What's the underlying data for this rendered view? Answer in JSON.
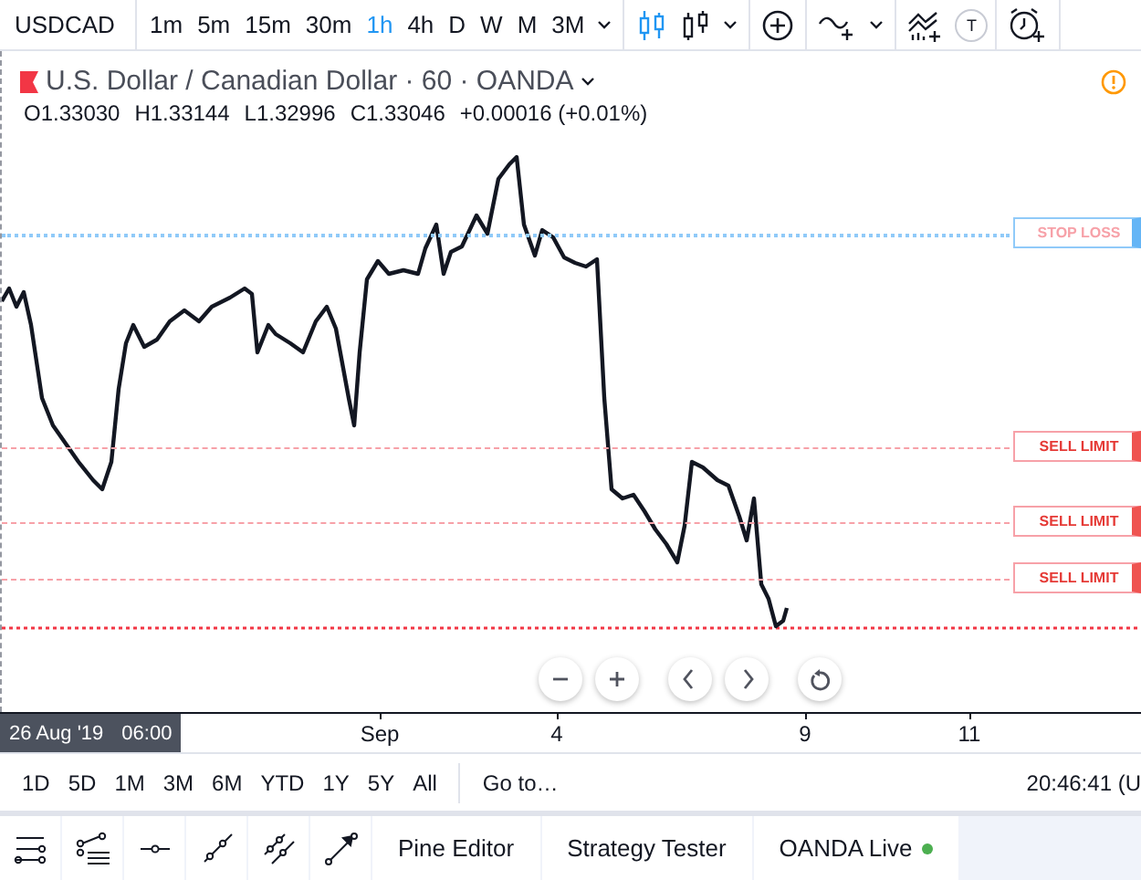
{
  "symbol": "USDCAD",
  "intervals": [
    {
      "label": "1m",
      "selected": false
    },
    {
      "label": "5m",
      "selected": false
    },
    {
      "label": "15m",
      "selected": false
    },
    {
      "label": "30m",
      "selected": false
    },
    {
      "label": "1h",
      "selected": true
    },
    {
      "label": "4h",
      "selected": false
    },
    {
      "label": "D",
      "selected": false
    },
    {
      "label": "W",
      "selected": false
    },
    {
      "label": "M",
      "selected": false
    },
    {
      "label": "3M",
      "selected": false
    }
  ],
  "text_tool": "T",
  "legend": {
    "title": "U.S. Dollar / Canadian Dollar · 60 · OANDA",
    "open": "O1.33030",
    "high": "H1.33144",
    "low": "L1.32996",
    "close": "C1.33046",
    "change": "+0.00016 (+0.01%)"
  },
  "order_lines": [
    {
      "kind": "stop",
      "label": "STOP LOSS"
    },
    {
      "kind": "limit",
      "label": "SELL LIMIT"
    },
    {
      "kind": "limit",
      "label": "SELL LIMIT"
    },
    {
      "kind": "limit",
      "label": "SELL LIMIT"
    }
  ],
  "time_axis": {
    "date": "26 Aug '19",
    "time": "06:00",
    "ticks": [
      "Sep",
      "4",
      "9",
      "11"
    ]
  },
  "ranges": [
    "1D",
    "5D",
    "1M",
    "3M",
    "6M",
    "YTD",
    "1Y",
    "5Y",
    "All"
  ],
  "goto": "Go to…",
  "clock": "20:46:41 (U",
  "bottom_tabs": [
    {
      "label": "Pine Editor",
      "connected": false
    },
    {
      "label": "Strategy Tester",
      "connected": false
    },
    {
      "label": "OANDA Live",
      "connected": true
    }
  ]
}
